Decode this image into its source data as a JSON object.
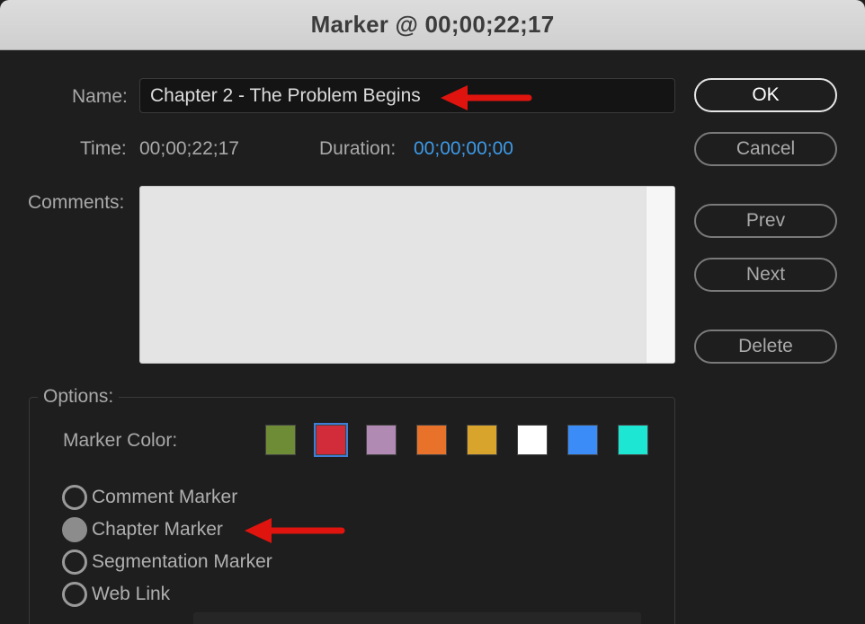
{
  "window": {
    "title": "Marker @ 00;00;22;17"
  },
  "name": {
    "label": "Name:",
    "value": "Chapter 2 - The Problem Begins"
  },
  "time": {
    "label": "Time:",
    "value": "00;00;22;17"
  },
  "duration": {
    "label": "Duration:",
    "value": "00;00;00;00",
    "color": "#3d9ae8"
  },
  "comments": {
    "label": "Comments:",
    "value": ""
  },
  "buttons": {
    "ok": "OK",
    "cancel": "Cancel",
    "prev": "Prev",
    "next": "Next",
    "delete": "Delete"
  },
  "options": {
    "legend": "Options:",
    "marker_color_label": "Marker Color:",
    "swatches": [
      {
        "name": "green",
        "color": "#6e8b35",
        "selected": false
      },
      {
        "name": "red",
        "color": "#d22b3a",
        "selected": true
      },
      {
        "name": "violet",
        "color": "#b08ab2",
        "selected": false
      },
      {
        "name": "orange",
        "color": "#e8722a",
        "selected": false
      },
      {
        "name": "yellow",
        "color": "#d8a42c",
        "selected": false
      },
      {
        "name": "white",
        "color": "#ffffff",
        "selected": false
      },
      {
        "name": "blue",
        "color": "#3b8cf7",
        "selected": false
      },
      {
        "name": "cyan",
        "color": "#1de6d3",
        "selected": false
      }
    ],
    "marker_types": [
      {
        "label": "Comment Marker",
        "checked": false
      },
      {
        "label": "Chapter Marker",
        "checked": true
      },
      {
        "label": "Segmentation Marker",
        "checked": false
      },
      {
        "label": "Web Link",
        "checked": false
      }
    ]
  },
  "annotation_arrow_color": "#e0140e"
}
